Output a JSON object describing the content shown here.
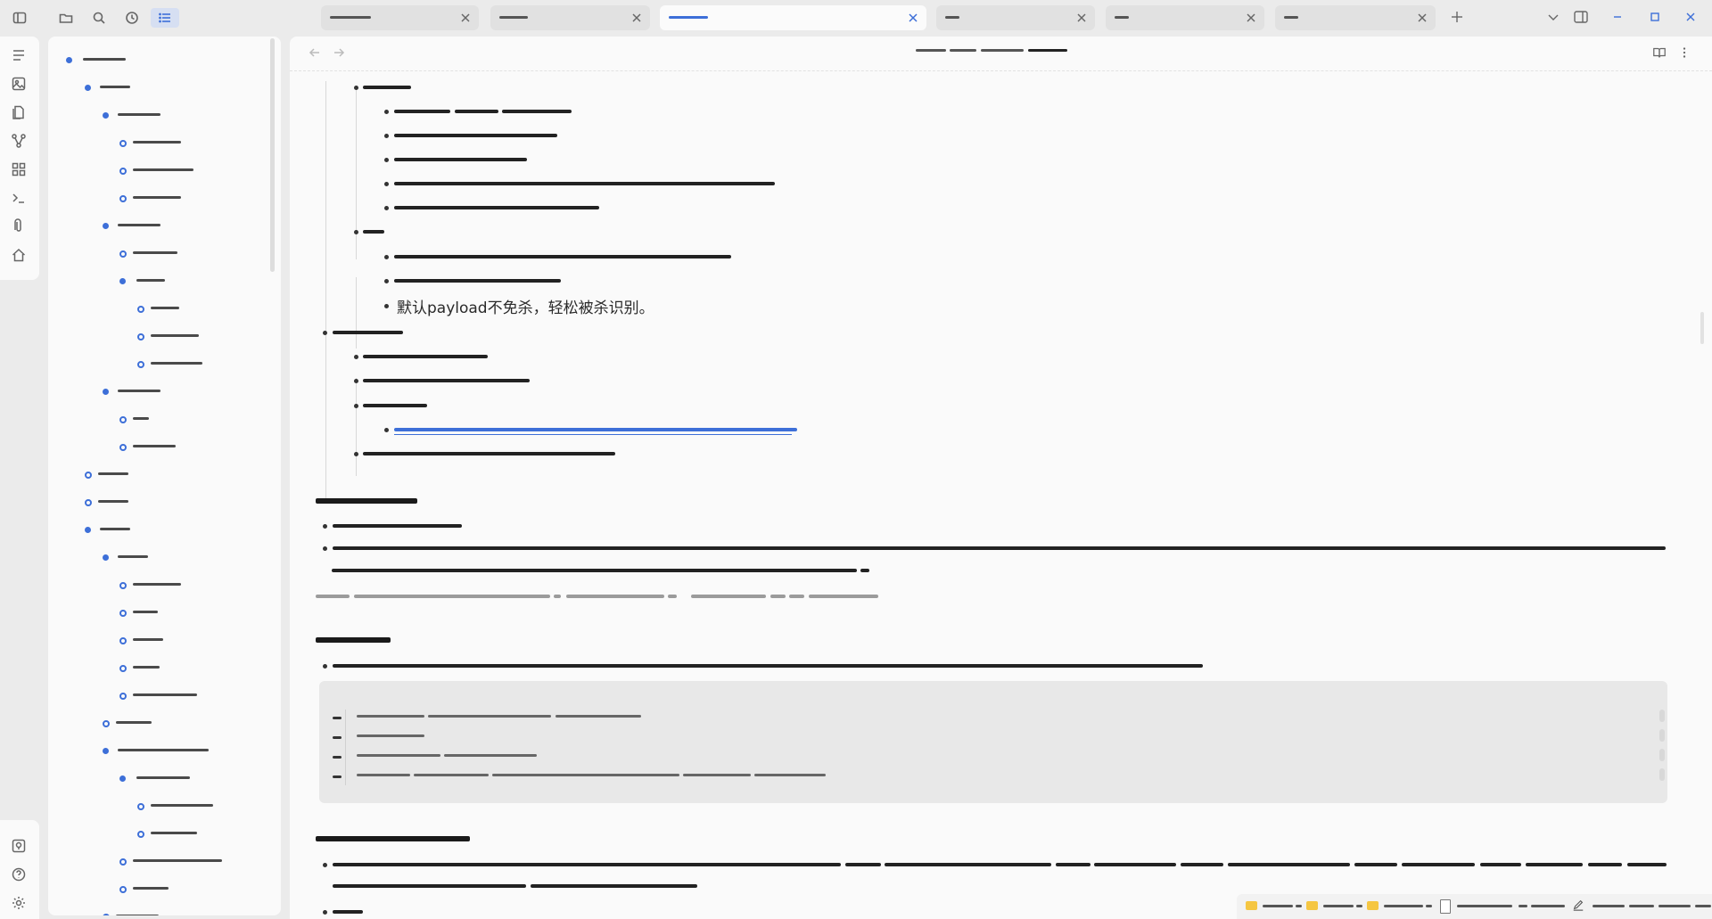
{
  "main": {
    "visible_text": "默认payload不免杀，轻松被杀识别。"
  },
  "colors": {
    "accent": "#3d6fd8",
    "background": "#ebebeb",
    "panel": "#fafafa",
    "code_background": "#e8e8e8",
    "folder": "#f5c642"
  },
  "icons": {
    "topbar_left": [
      "sidebar-toggle-icon",
      "folder-icon",
      "search-icon",
      "clock-icon",
      "outline-list-icon"
    ],
    "ribbon": [
      "lines-icon",
      "image-icon",
      "files-icon",
      "graph-icon",
      "grid-icon",
      "terminal-icon",
      "clip-icon",
      "home-icon"
    ],
    "ribbon_bottom": [
      "vault-icon",
      "help-icon",
      "settings-icon"
    ],
    "header_right": [
      "reading-mode-icon",
      "more-options-icon"
    ]
  }
}
